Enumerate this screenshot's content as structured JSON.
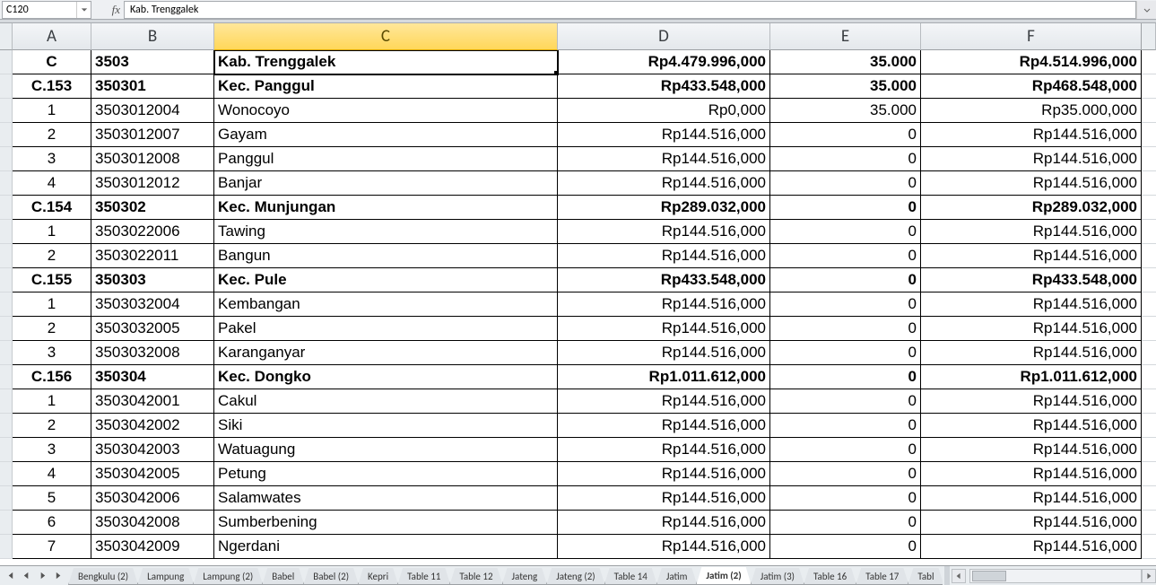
{
  "nameBox": "C120",
  "formula": "Kab.  Trenggalek",
  "columns": [
    "A",
    "B",
    "C",
    "D",
    "E",
    "F"
  ],
  "activeColIndex": 2,
  "rows": [
    {
      "bold": true,
      "a": "C",
      "b": "3503",
      "c": "Kab.  Trenggalek",
      "d": "Rp4.479.996,000",
      "e": "35.000",
      "f": "Rp4.514.996,000",
      "active": true
    },
    {
      "bold": true,
      "a": "C.153",
      "b": "350301",
      "c": "Kec.  Panggul",
      "d": "Rp433.548,000",
      "e": "35.000",
      "f": "Rp468.548,000"
    },
    {
      "bold": false,
      "a": "1",
      "b": "3503012004",
      "c": "Wonocoyo",
      "d": "Rp0,000",
      "e": "35.000",
      "f": "Rp35.000,000"
    },
    {
      "bold": false,
      "a": "2",
      "b": "3503012007",
      "c": "Gayam",
      "d": "Rp144.516,000",
      "e": "0",
      "f": "Rp144.516,000"
    },
    {
      "bold": false,
      "a": "3",
      "b": "3503012008",
      "c": "Panggul",
      "d": "Rp144.516,000",
      "e": "0",
      "f": "Rp144.516,000"
    },
    {
      "bold": false,
      "a": "4",
      "b": "3503012012",
      "c": "Banjar",
      "d": "Rp144.516,000",
      "e": "0",
      "f": "Rp144.516,000"
    },
    {
      "bold": true,
      "a": "C.154",
      "b": "350302",
      "c": "Kec.  Munjungan",
      "d": "Rp289.032,000",
      "e": "0",
      "f": "Rp289.032,000"
    },
    {
      "bold": false,
      "a": "1",
      "b": "3503022006",
      "c": "Tawing",
      "d": "Rp144.516,000",
      "e": "0",
      "f": "Rp144.516,000"
    },
    {
      "bold": false,
      "a": "2",
      "b": "3503022011",
      "c": "Bangun",
      "d": "Rp144.516,000",
      "e": "0",
      "f": "Rp144.516,000"
    },
    {
      "bold": true,
      "a": "C.155",
      "b": "350303",
      "c": "Kec.  Pule",
      "d": "Rp433.548,000",
      "e": "0",
      "f": "Rp433.548,000"
    },
    {
      "bold": false,
      "a": "1",
      "b": "3503032004",
      "c": "Kembangan",
      "d": "Rp144.516,000",
      "e": "0",
      "f": "Rp144.516,000"
    },
    {
      "bold": false,
      "a": "2",
      "b": "3503032005",
      "c": "Pakel",
      "d": "Rp144.516,000",
      "e": "0",
      "f": "Rp144.516,000"
    },
    {
      "bold": false,
      "a": "3",
      "b": "3503032008",
      "c": "Karanganyar",
      "d": "Rp144.516,000",
      "e": "0",
      "f": "Rp144.516,000"
    },
    {
      "bold": true,
      "a": "C.156",
      "b": "350304",
      "c": "Kec.  Dongko",
      "d": "Rp1.011.612,000",
      "e": "0",
      "f": "Rp1.011.612,000"
    },
    {
      "bold": false,
      "a": "1",
      "b": "3503042001",
      "c": "Cakul",
      "d": "Rp144.516,000",
      "e": "0",
      "f": "Rp144.516,000"
    },
    {
      "bold": false,
      "a": "2",
      "b": "3503042002",
      "c": "Siki",
      "d": "Rp144.516,000",
      "e": "0",
      "f": "Rp144.516,000"
    },
    {
      "bold": false,
      "a": "3",
      "b": "3503042003",
      "c": "Watuagung",
      "d": "Rp144.516,000",
      "e": "0",
      "f": "Rp144.516,000"
    },
    {
      "bold": false,
      "a": "4",
      "b": "3503042005",
      "c": "Petung",
      "d": "Rp144.516,000",
      "e": "0",
      "f": "Rp144.516,000"
    },
    {
      "bold": false,
      "a": "5",
      "b": "3503042006",
      "c": "Salamwates",
      "d": "Rp144.516,000",
      "e": "0",
      "f": "Rp144.516,000"
    },
    {
      "bold": false,
      "a": "6",
      "b": "3503042008",
      "c": "Sumberbening",
      "d": "Rp144.516,000",
      "e": "0",
      "f": "Rp144.516,000"
    },
    {
      "bold": false,
      "a": "7",
      "b": "3503042009",
      "c": "Ngerdani",
      "d": "Rp144.516,000",
      "e": "0",
      "f": "Rp144.516,000"
    }
  ],
  "tabs": [
    "Bengkulu (2)",
    "Lampung",
    "Lampung (2)",
    "Babel",
    "Babel (2)",
    "Kepri",
    "Table 11",
    "Table 12",
    "Jateng",
    "Jateng (2)",
    "Table 14",
    "Jatim",
    "Jatim (2)",
    "Jatim (3)",
    "Table 16",
    "Table 17",
    "Tabl"
  ],
  "activeTabIndex": 12
}
